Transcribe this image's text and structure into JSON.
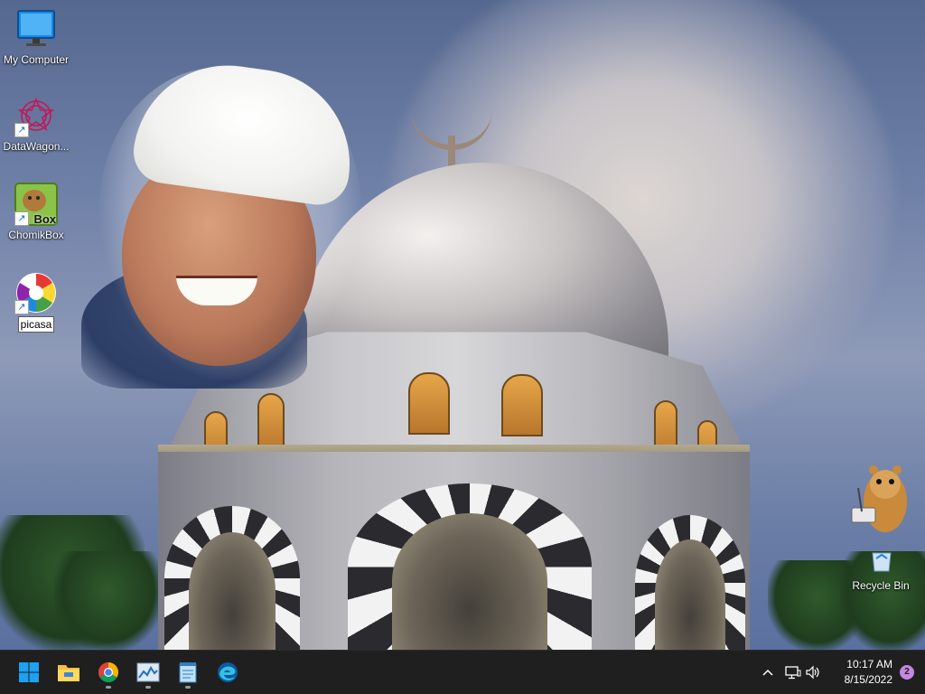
{
  "desktop": {
    "icons": [
      {
        "label": "My Computer",
        "icon": "monitor-icon"
      },
      {
        "label": "DataWagon...",
        "icon": "datawagon-icon"
      },
      {
        "label": "ChomikBox",
        "icon": "chomikbox-icon",
        "glyph_text": "Box"
      },
      {
        "label": "picasa",
        "icon": "picasa-icon"
      },
      {
        "label": "Recycle Bin",
        "icon": "recycle-bin-icon"
      }
    ]
  },
  "taskbar": {
    "apps": [
      {
        "name": "Start",
        "icon": "windows-start-icon"
      },
      {
        "name": "File Explorer",
        "icon": "folder-icon"
      },
      {
        "name": "Google Chrome",
        "icon": "chrome-icon"
      },
      {
        "name": "Task Manager",
        "icon": "task-manager-icon"
      },
      {
        "name": "Notepad",
        "icon": "notepad-icon"
      },
      {
        "name": "Microsoft Edge",
        "icon": "edge-icon"
      }
    ],
    "tray": {
      "time": "10:17 AM",
      "date": "8/15/2022",
      "notification_count": "2"
    }
  },
  "colors": {
    "taskbar_bg": "#1f1f1f",
    "accent_blue": "#0078d4",
    "badge": "#c586e0"
  }
}
